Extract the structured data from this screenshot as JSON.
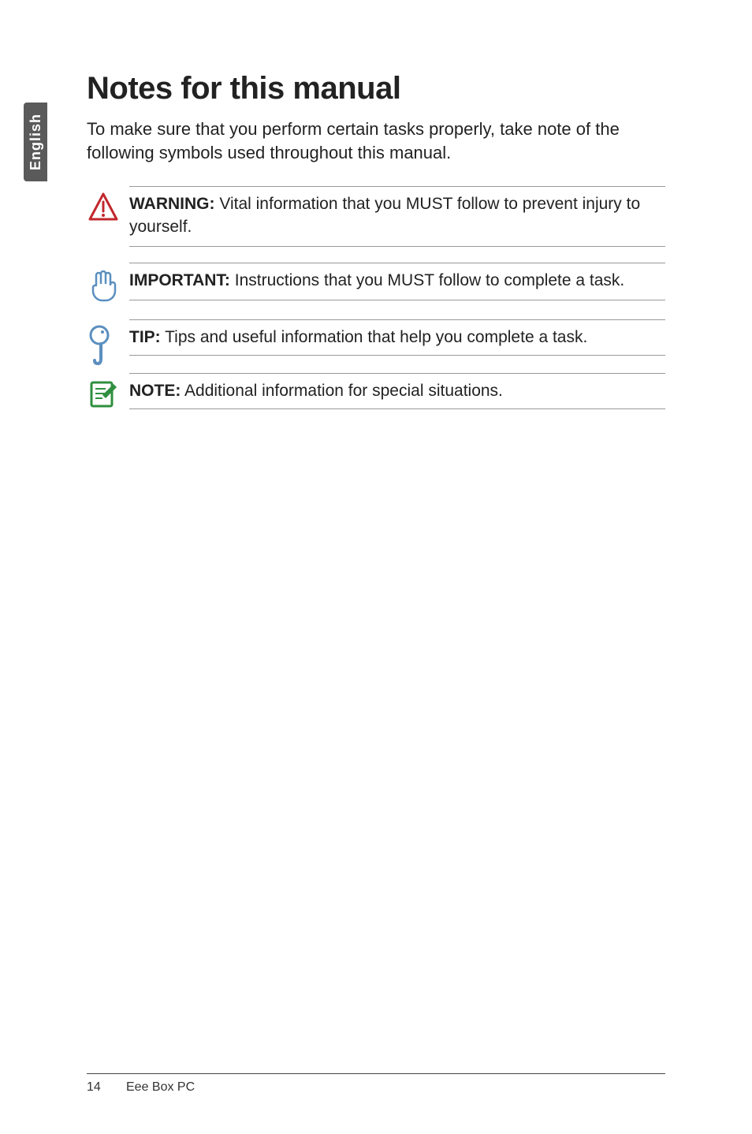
{
  "sideTab": {
    "label": "English"
  },
  "heading": "Notes for this manual",
  "intro": "To make sure that you perform certain tasks properly, take note of the following symbols used throughout this manual.",
  "notes": {
    "warning": {
      "label": "WARNING:",
      "text": " Vital information that you MUST follow to prevent injury to yourself."
    },
    "important": {
      "label": "IMPORTANT:",
      "text": " Instructions that you MUST follow to complete a task."
    },
    "tip": {
      "label": "TIP:",
      "text": " Tips and useful information that help you complete a task."
    },
    "note": {
      "label": "NOTE:",
      "text": " Additional information for special situations."
    }
  },
  "footer": {
    "page": "14",
    "title": "Eee Box PC"
  }
}
